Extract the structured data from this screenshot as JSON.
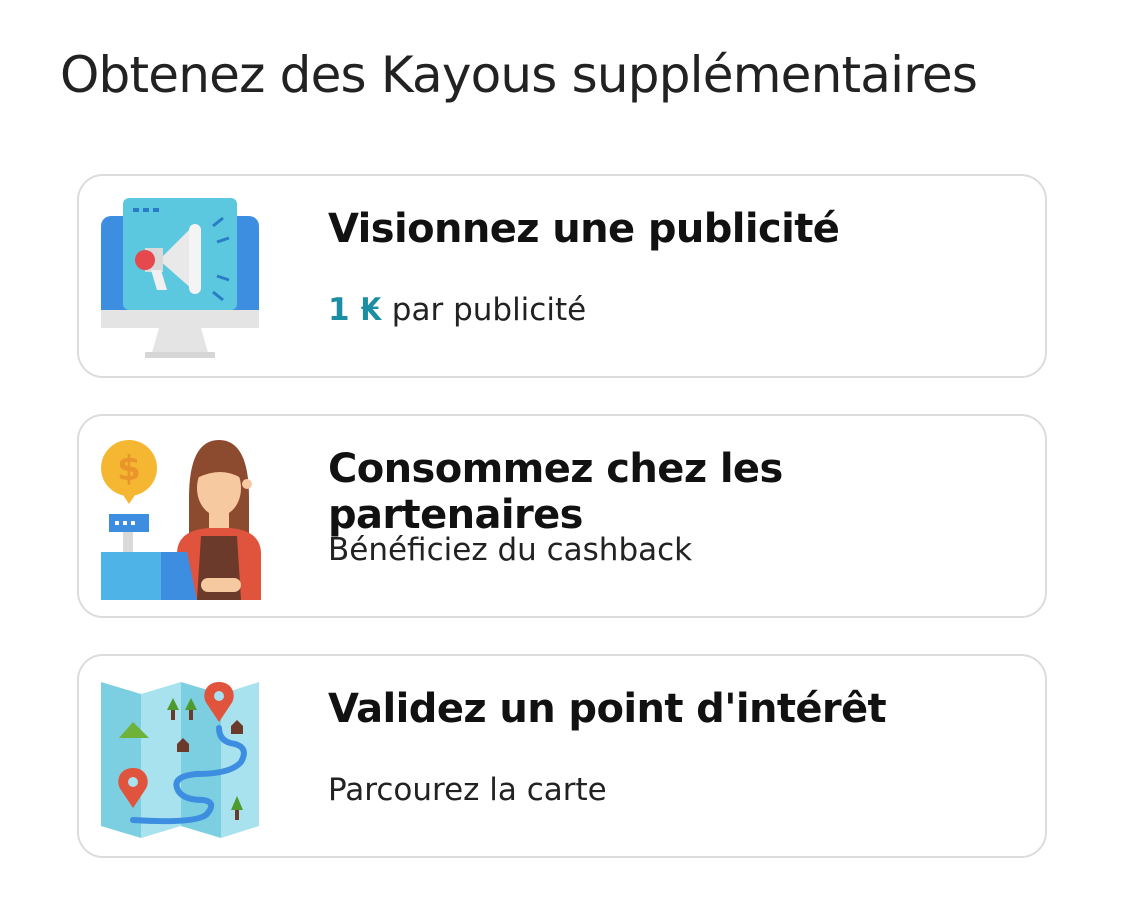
{
  "page": {
    "title": "Obtenez des Kayous supplémentaires"
  },
  "cards": [
    {
      "heading": "Visionnez une publicité",
      "reward": "1 ₭",
      "sub": "par publicité",
      "icon": "advertising-monitor-icon"
    },
    {
      "heading": "Consommez chez les partenaires",
      "sub": "Bénéficiez du cashback",
      "icon": "cashier-cashback-icon"
    },
    {
      "heading": "Validez un point d'intérêt",
      "sub": "Parcourez la carte",
      "icon": "map-pins-icon"
    }
  ],
  "colors": {
    "accent": "#1b8ea3",
    "card_border": "#dcdcdc",
    "text": "#1f1f1f"
  }
}
